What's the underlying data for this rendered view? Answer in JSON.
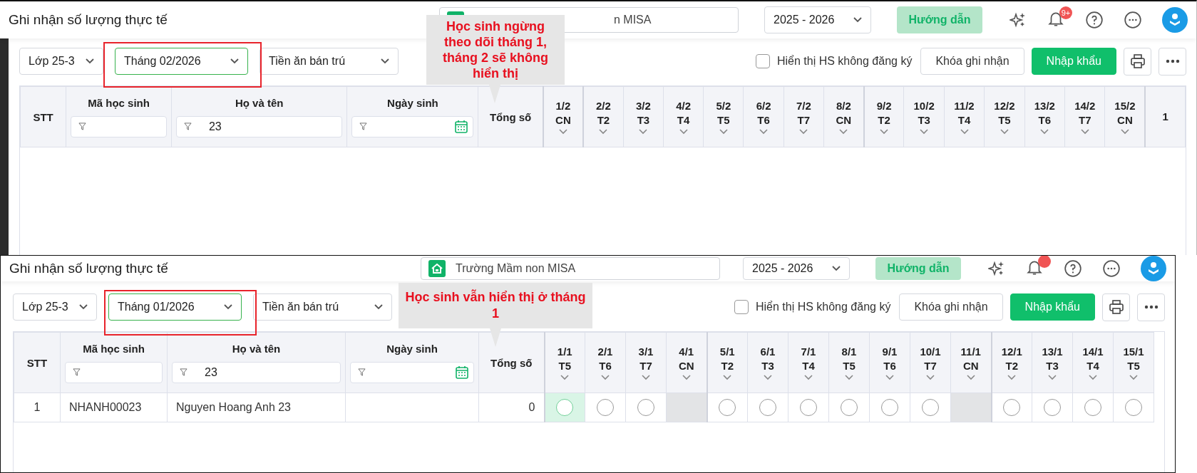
{
  "panels": [
    {
      "title": "Ghi nhận số lượng thực tế",
      "search": {
        "value": "n MISA"
      },
      "year": "2025 - 2026",
      "guide_button": "Hướng dẫn",
      "notifications": {
        "unread": true,
        "badge": "9+"
      },
      "filters": [
        {
          "label": "Lớp 25-3",
          "highlighted": false
        },
        {
          "label": "Tháng 02/2026",
          "highlighted": true
        },
        {
          "label": "Tiền ăn bán trú",
          "highlighted": false
        }
      ],
      "show_unregistered": {
        "label": "Hiển thị HS không đăng ký",
        "checked": false
      },
      "lock_button": "Khóa ghi nhận",
      "import_button": "Nhập khẩu",
      "callout": "Học sinh ngừng theo dõi tháng 1, tháng 2 sẽ không hiển thị",
      "columns": [
        "STT",
        "Mã học sinh",
        "Họ và tên",
        "Ngày sinh",
        "Tổng số"
      ],
      "filter_values": {
        "name": "23"
      },
      "days": [
        {
          "date": "1/2",
          "weekday": "CN",
          "week_end": true
        },
        {
          "date": "2/2",
          "weekday": "T2",
          "week_end": false
        },
        {
          "date": "3/2",
          "weekday": "T3",
          "week_end": false
        },
        {
          "date": "4/2",
          "weekday": "T4",
          "week_end": false
        },
        {
          "date": "5/2",
          "weekday": "T5",
          "week_end": false
        },
        {
          "date": "6/2",
          "weekday": "T6",
          "week_end": false
        },
        {
          "date": "7/2",
          "weekday": "T7",
          "week_end": false
        },
        {
          "date": "8/2",
          "weekday": "CN",
          "week_end": true
        },
        {
          "date": "9/2",
          "weekday": "T2",
          "week_end": false
        },
        {
          "date": "10/2",
          "weekday": "T3",
          "week_end": false
        },
        {
          "date": "11/2",
          "weekday": "T4",
          "week_end": false
        },
        {
          "date": "12/2",
          "weekday": "T5",
          "week_end": false
        },
        {
          "date": "13/2",
          "weekday": "T6",
          "week_end": false
        },
        {
          "date": "14/2",
          "weekday": "T7",
          "week_end": false
        },
        {
          "date": "15/2",
          "weekday": "CN",
          "week_end": true
        },
        {
          "date": "1",
          "week_end": false
        }
      ]
    },
    {
      "title": "Ghi nhận số lượng thực tế",
      "search": {
        "value": "Trường Mầm non MISA"
      },
      "year": "2025 - 2026",
      "guide_button": "Hướng dẫn",
      "notifications": {
        "unread": true
      },
      "filters": [
        {
          "label": "Lớp 25-3",
          "highlighted": false
        },
        {
          "label": "Tháng 01/2026",
          "highlighted": true
        },
        {
          "label": "Tiền ăn bán trú",
          "highlighted": false
        }
      ],
      "show_unregistered": {
        "label": "Hiển thị HS không đăng ký",
        "checked": false
      },
      "lock_button": "Khóa ghi nhận",
      "import_button": "Nhập khẩu",
      "callout": "Học sinh vẫn hiển thị ở tháng 1",
      "columns": [
        "STT",
        "Mã học sinh",
        "Họ và tên",
        "Ngày sinh",
        "Tổng số"
      ],
      "filter_values": {
        "name": "23"
      },
      "days": [
        {
          "date": "1/1",
          "weekday": "T5",
          "week_end": false
        },
        {
          "date": "2/1",
          "weekday": "T6",
          "week_end": false
        },
        {
          "date": "3/1",
          "weekday": "T7",
          "week_end": false
        },
        {
          "date": "4/1",
          "weekday": "CN",
          "week_end": true
        },
        {
          "date": "5/1",
          "weekday": "T2",
          "week_end": false
        },
        {
          "date": "6/1",
          "weekday": "T3",
          "week_end": false
        },
        {
          "date": "7/1",
          "weekday": "T4",
          "week_end": false
        },
        {
          "date": "8/1",
          "weekday": "T5",
          "week_end": false
        },
        {
          "date": "9/1",
          "weekday": "T6",
          "week_end": false
        },
        {
          "date": "10/1",
          "weekday": "T7",
          "week_end": false
        },
        {
          "date": "11/1",
          "weekday": "CN",
          "week_end": true
        },
        {
          "date": "12/1",
          "weekday": "T2",
          "week_end": false
        },
        {
          "date": "13/1",
          "weekday": "T3",
          "week_end": false
        },
        {
          "date": "14/1",
          "weekday": "T4",
          "week_end": false
        },
        {
          "date": "15/1",
          "weekday": "T5",
          "week_end": false
        }
      ],
      "rows": [
        {
          "stt": "1",
          "code": "NHANH00023",
          "name": "Nguyen Hoang Anh 23",
          "total": "0",
          "cells": [
            {
              "kind": "circle",
              "selected": true
            },
            {
              "kind": "circle",
              "selected": false
            },
            {
              "kind": "circle",
              "selected": false
            },
            {
              "kind": "off"
            },
            {
              "kind": "circle",
              "selected": false
            },
            {
              "kind": "circle",
              "selected": false
            },
            {
              "kind": "circle",
              "selected": false
            },
            {
              "kind": "circle",
              "selected": false
            },
            {
              "kind": "circle",
              "selected": false
            },
            {
              "kind": "circle",
              "selected": false
            },
            {
              "kind": "off"
            },
            {
              "kind": "circle",
              "selected": false
            },
            {
              "kind": "circle",
              "selected": false
            },
            {
              "kind": "circle",
              "selected": false
            },
            {
              "kind": "circle",
              "selected": false
            }
          ]
        }
      ]
    }
  ]
}
